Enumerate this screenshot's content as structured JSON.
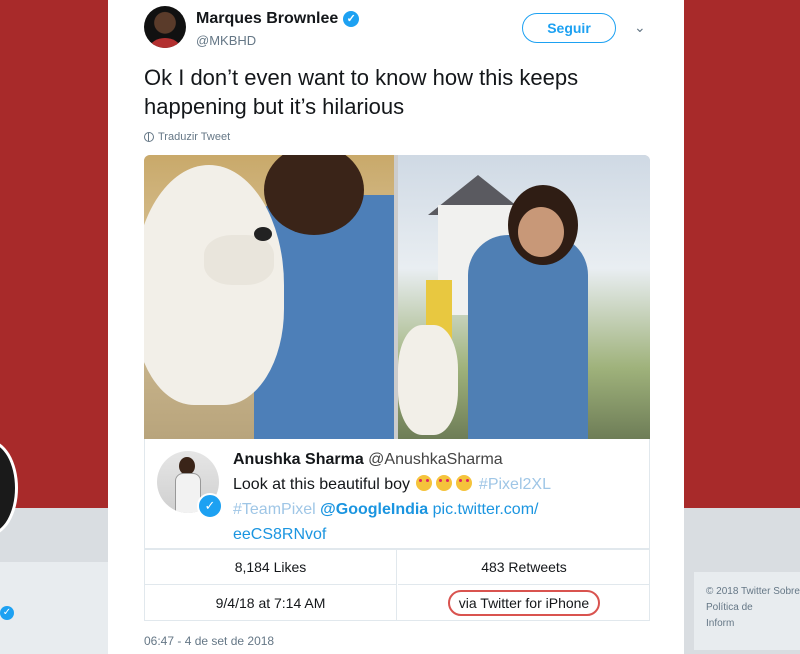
{
  "background": {
    "footer_lines": [
      "© 2018 Twitter  Sobre",
      "Política de",
      "Inform"
    ]
  },
  "tweet": {
    "display_name": "Marques Brownlee",
    "handle": "@MKBHD",
    "follow_label": "Seguir",
    "text": "Ok I don’t even want to know how this keeps happening but it’s hilarious",
    "translate_label": "Traduzir Tweet",
    "timestamp": "06:47 - 4 de set de 2018"
  },
  "embedded": {
    "name": "Anushka Sharma",
    "handle": "@AnushkaSharma",
    "text_start": "Look at this beautiful boy",
    "hashtag1": "#Pixel2XL",
    "hashtag2": "#TeamPixel",
    "mention": "@GoogleIndia",
    "link_line1": "pic.twitter.com/",
    "link_line2": "eeCS8RNvof"
  },
  "stats": {
    "likes": "8,184 Likes",
    "retweets": "483 Retweets",
    "date": "9/4/18 at 7:14 AM",
    "source": "via Twitter for iPhone"
  },
  "colors": {
    "accent": "#1da1f2",
    "background": "#a82a2a",
    "circle": "#d9534f"
  }
}
